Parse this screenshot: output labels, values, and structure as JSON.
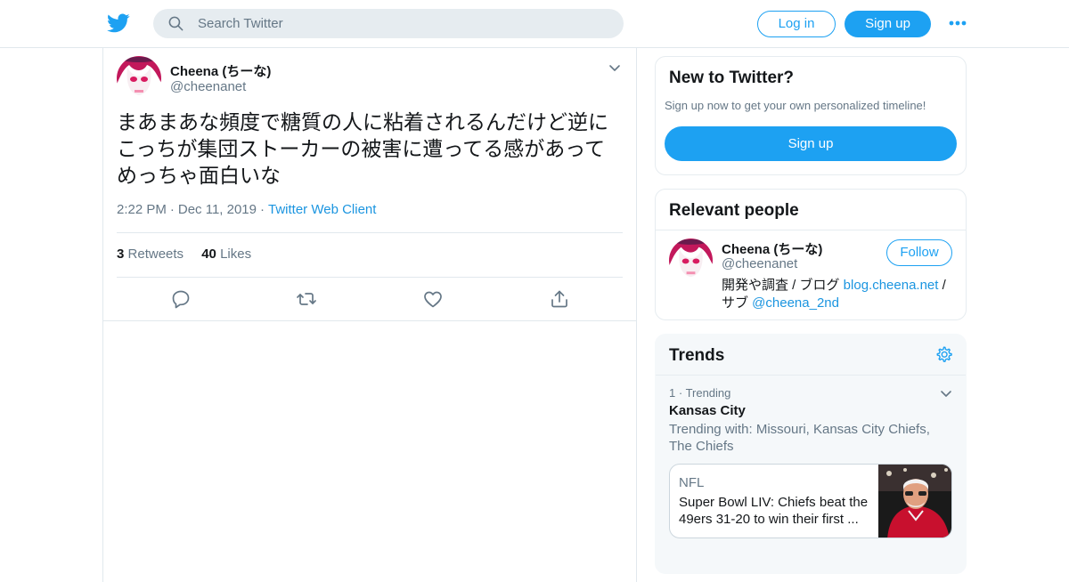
{
  "search": {
    "placeholder": "Search Twitter"
  },
  "header": {
    "login_label": "Log in",
    "signup_label": "Sign up"
  },
  "tweet": {
    "display_name": "Cheena (ちーな)",
    "handle": "@cheenanet",
    "text_line1": "まあまあな頻度で糖質の人に粘着されるんだけど逆に",
    "text_line2": "こっちが集団ストーカーの被害に遭ってる感があって",
    "text_line3": "めっちゃ面白いな",
    "time": "2:22 PM",
    "date": "Dec 11, 2019",
    "source": "Twitter Web Client",
    "retweets_count": "3",
    "retweets_label": "Retweets",
    "likes_count": "40",
    "likes_label": "Likes"
  },
  "new_to_twitter": {
    "title": "New to Twitter?",
    "subtitle": "Sign up now to get your own personalized timeline!",
    "signup_label": "Sign up"
  },
  "relevant_people": {
    "title": "Relevant people",
    "name": "Cheena (ちーな)",
    "handle": "@cheenanet",
    "follow_label": "Follow",
    "bio_prefix": "開発や調査 / ブログ ",
    "bio_link": "blog.cheena.net",
    "bio_mid": " / サブ ",
    "bio_mention": "@cheena_2nd"
  },
  "trends": {
    "title": "Trends",
    "rank": "1",
    "rank_label": "Trending",
    "name": "Kansas City",
    "trending_with": "Trending with: Missouri, Kansas City Chiefs, The Chiefs",
    "news_category": "NFL",
    "news_title": "Super Bowl LIV: Chiefs beat the 49ers 31-20 to win their first ..."
  },
  "colors": {
    "brand": "#1da1f2",
    "link": "#1b95e0",
    "secondary_text": "#657786",
    "border": "#e1e8ed"
  },
  "icons": [
    "twitter-bird-icon",
    "search-icon",
    "more-dots-icon",
    "chevron-down-icon",
    "reply-icon",
    "retweet-icon",
    "like-icon",
    "share-icon",
    "gear-icon"
  ]
}
